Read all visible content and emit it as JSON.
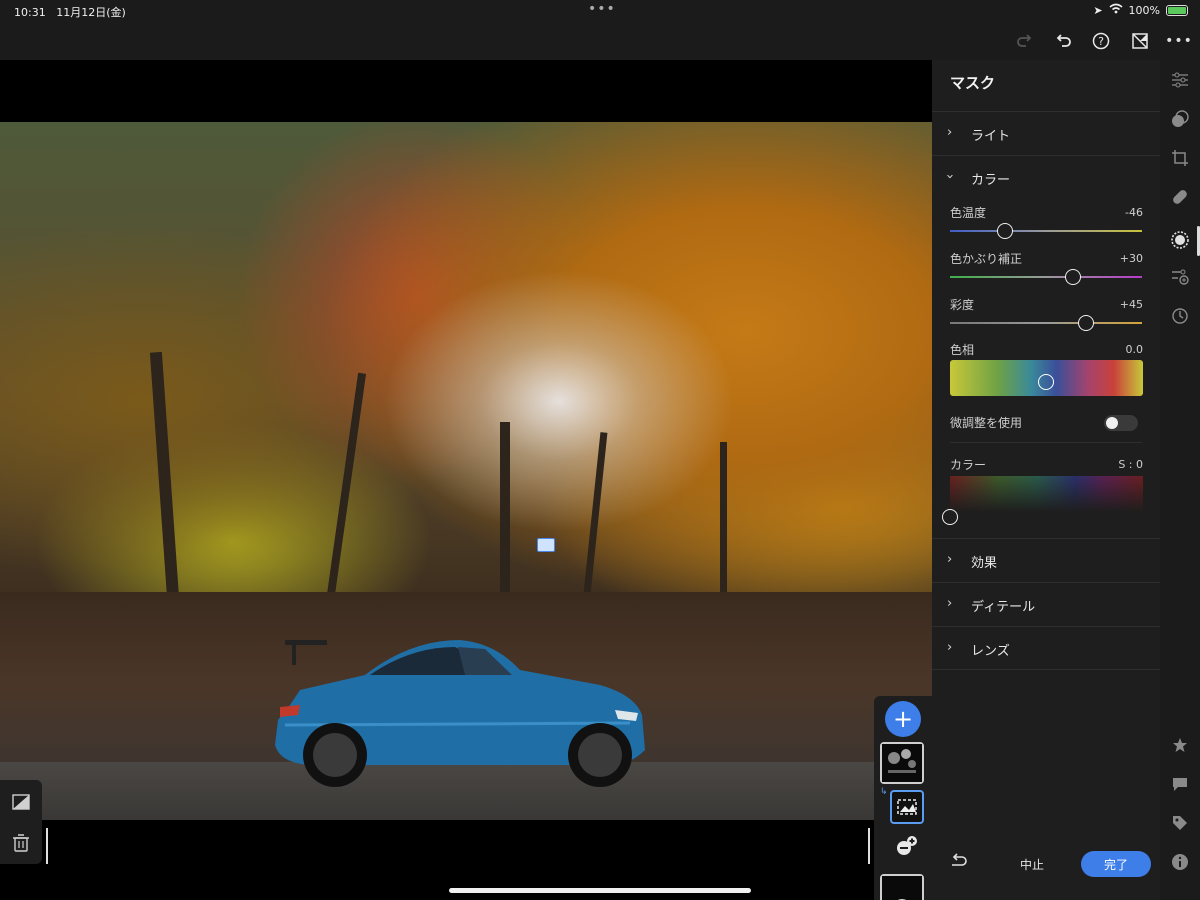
{
  "status_bar": {
    "time": "10:31",
    "date": "11月12日(金)",
    "battery": "100%",
    "icons": [
      "location-icon",
      "wifi-icon",
      "battery-icon"
    ]
  },
  "toolbar": {
    "icons": [
      "redo-icon",
      "undo-icon",
      "help-icon",
      "compare-icon",
      "more-icon"
    ]
  },
  "panel": {
    "title": "マスク",
    "sections": [
      {
        "label": "ライト",
        "expanded": false
      },
      {
        "label": "カラー",
        "expanded": true
      },
      {
        "label": "効果",
        "expanded": false
      },
      {
        "label": "ディテール",
        "expanded": false
      },
      {
        "label": "レンズ",
        "expanded": false
      }
    ],
    "color": {
      "temp": {
        "label": "色温度",
        "value": "-46",
        "level": -46
      },
      "tint": {
        "label": "色かぶり補正",
        "value": "+30",
        "level": 30
      },
      "saturation": {
        "label": "彩度",
        "value": "+45",
        "level": 45
      },
      "hue": {
        "label": "色相",
        "value": "0.0"
      },
      "fine_adjust": {
        "label": "微調整を使用",
        "on": false
      },
      "color_picker": {
        "label": "カラー",
        "value": "S : 0"
      }
    },
    "footer": {
      "cancel": "中止",
      "done": "完了"
    }
  },
  "mask_stack": {
    "add_label": "+"
  },
  "colors": {
    "accent": "#3d7ee8",
    "panel_bg": "#1e1e1e",
    "toolbar_bg": "#1b1b1b"
  }
}
